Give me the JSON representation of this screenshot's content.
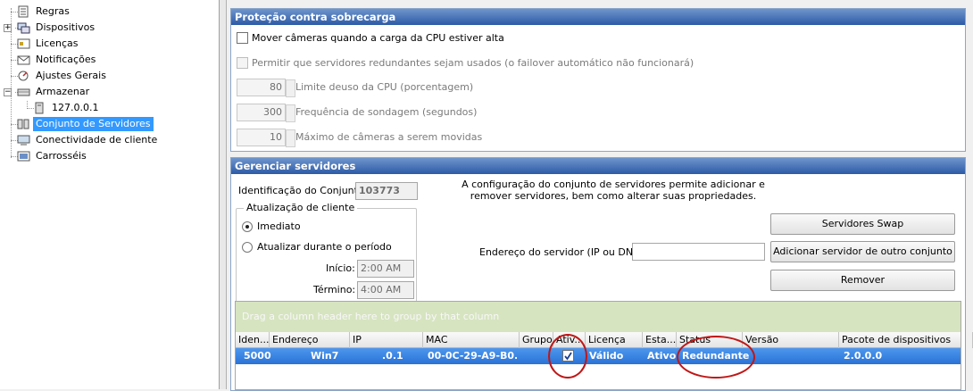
{
  "tree": {
    "items": [
      {
        "label": "Regras",
        "icon": "rules-icon"
      },
      {
        "label": "Dispositivos",
        "icon": "devices-icon"
      },
      {
        "label": "Licenças",
        "icon": "license-icon"
      },
      {
        "label": "Notificações",
        "icon": "notification-icon"
      },
      {
        "label": "Ajustes Gerais",
        "icon": "settings-icon"
      },
      {
        "label": "Armazenar",
        "icon": "storage-icon"
      },
      {
        "label": "127.0.0.1",
        "icon": "server-icon"
      },
      {
        "label": "Conjunto de Servidores",
        "icon": "server-pool-icon",
        "selected": true
      },
      {
        "label": "Conectividade de cliente",
        "icon": "client-connectivity-icon"
      },
      {
        "label": "Carrosséis",
        "icon": "carousel-icon"
      }
    ]
  },
  "overload": {
    "title": "Proteção contra sobrecarga",
    "move_cameras_label": "Mover câmeras quando a carga da CPU estiver alta",
    "allow_redundant_label": "Permitir que servidores redundantes sejam usados (o failover automático não funcionará)",
    "cpu_limit_value": "80",
    "cpu_limit_label": "Limite deuso da CPU (porcentagem)",
    "poll_value": "300",
    "poll_label": "Frequência de sondagem (segundos)",
    "max_cameras_value": "10",
    "max_cameras_label": "Máximo de câmeras a serem movidas"
  },
  "manage": {
    "title": "Gerenciar servidores",
    "pool_id_label": "Identificação do Conjunto",
    "pool_id_value": "103773",
    "description": "A configuração do conjunto de servidores permite adicionar e remover servidores, bem como alterar suas propriedades.",
    "client_update_legend": "Atualização de cliente",
    "immediate_label": "Imediato",
    "period_label": "Atualizar durante o período",
    "start_label": "Início:",
    "start_value": "2:00 AM",
    "end_label": "Término:",
    "end_value": "4:00 AM",
    "server_address_label": "Endereço do servidor (IP ou DNS)",
    "server_address_value": "",
    "swap_button": "Servidores Swap",
    "add_button": "Adicionar servidor de outro conjunto",
    "remove_button": "Remover"
  },
  "grid": {
    "group_panel_text": "Drag a column header here to group by that column",
    "columns": [
      "Iden...",
      "Endereço",
      "IP",
      "MAC",
      "Grupo",
      "Ativ...",
      "Licença",
      "Esta...",
      "Status",
      "Versão",
      "Pacote de dispositivos"
    ],
    "rows": [
      {
        "id": "5000",
        "address": "Win7",
        "ip": ".0.1",
        "mac": "00-0C-29-A9-B0...",
        "group": "",
        "active": true,
        "license": "Válido",
        "state": "Ativo",
        "status": "Redundante",
        "version": "",
        "package": "2.0.0.0"
      }
    ]
  },
  "colors": {
    "accent": "#2c5aa6",
    "selection": "#3399ff",
    "annotation": "#c01616"
  }
}
